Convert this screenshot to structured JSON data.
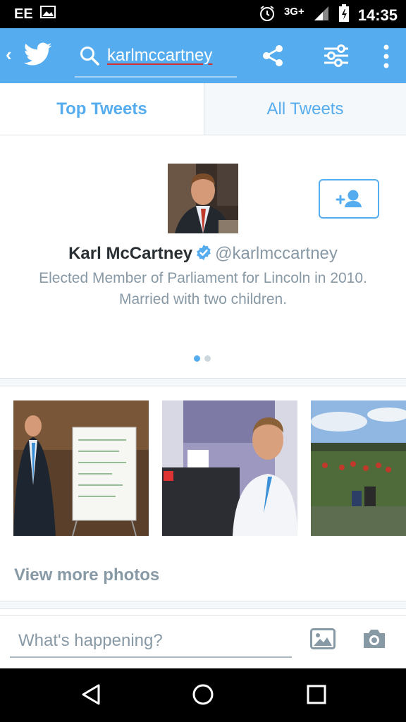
{
  "status_bar": {
    "carrier": "EE",
    "network": "3G+",
    "time": "14:35"
  },
  "search": {
    "query": "karlmccartney"
  },
  "tabs": [
    {
      "label": "Top Tweets"
    },
    {
      "label": "All Tweets"
    }
  ],
  "profile": {
    "name": "Karl McCartney",
    "handle": "@karlmccartney",
    "bio_line1": "Elected Member of Parliament for Lincoln in 2010.",
    "bio_line2": "Married with two children."
  },
  "photos": {
    "view_more_label": "View more photos"
  },
  "compose": {
    "placeholder": "What's happening?"
  },
  "colors": {
    "twitter_blue": "#55acee",
    "gray_text": "#8899a6"
  },
  "icons": [
    "back-chevron-icon",
    "twitter-bird-icon",
    "search-icon",
    "share-icon",
    "filter-icon",
    "more-vert-icon",
    "follow-icon",
    "verified-icon",
    "image-icon",
    "camera-icon",
    "nav-back-icon",
    "nav-home-icon",
    "nav-recents-icon"
  ]
}
